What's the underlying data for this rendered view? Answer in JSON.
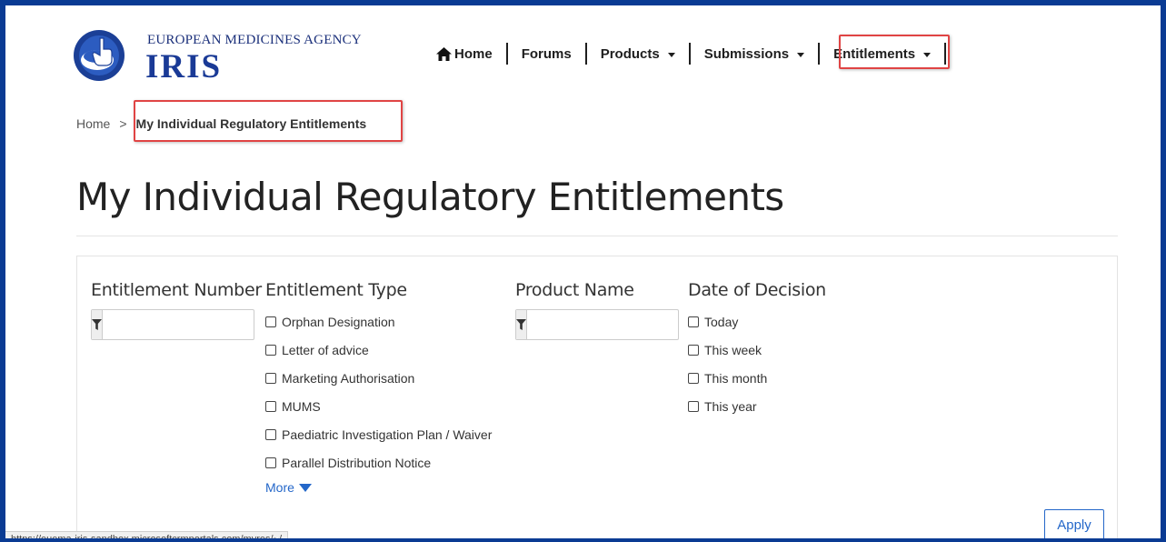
{
  "header": {
    "agency_name": "EUROPEAN MEDICINES AGENCY",
    "product_name": "IRIS",
    "nav": [
      {
        "label": "Home",
        "icon": "home-icon",
        "has_dropdown": false
      },
      {
        "label": "Forums",
        "has_dropdown": false
      },
      {
        "label": "Products",
        "has_dropdown": true
      },
      {
        "label": "Submissions",
        "has_dropdown": true
      },
      {
        "label": "Entitlements",
        "has_dropdown": true,
        "highlighted": true
      }
    ]
  },
  "breadcrumb": {
    "home": "Home",
    "separator": ">",
    "current": "My Individual Regulatory Entitlements"
  },
  "page": {
    "title": "My Individual Regulatory Entitlements"
  },
  "filters": {
    "entitlement_number": {
      "label": "Entitlement Number",
      "value": ""
    },
    "entitlement_type": {
      "label": "Entitlement Type",
      "options": [
        "Orphan Designation",
        "Letter of advice",
        "Marketing Authorisation",
        "MUMS",
        "Paediatric Investigation Plan / Waiver",
        "Parallel Distribution Notice"
      ],
      "more_label": "More"
    },
    "product_name": {
      "label": "Product Name",
      "value": ""
    },
    "date_of_decision": {
      "label": "Date of Decision",
      "options": [
        "Today",
        "This week",
        "This month",
        "This year"
      ]
    },
    "apply_label": "Apply"
  },
  "status_bar": {
    "url": "https://euema-iris-sandbox.microsoftcrmportals.com/myres/~/"
  },
  "colors": {
    "frame_border": "#0a3b93",
    "highlight": "#e04444",
    "link": "#2467c9",
    "brand": "#1a3a96"
  }
}
